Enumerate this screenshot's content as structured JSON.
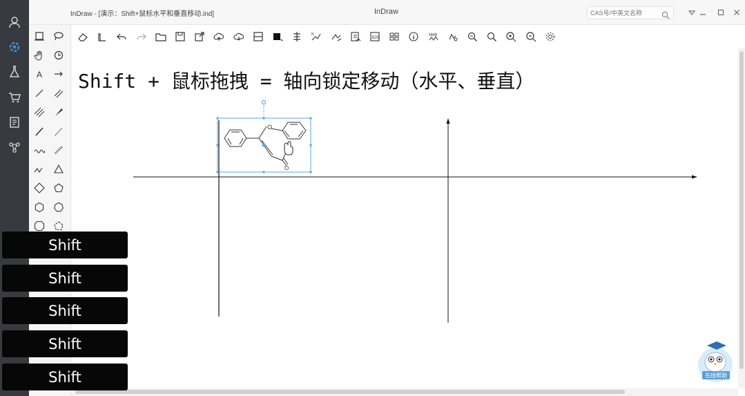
{
  "window": {
    "doc_title": "InDraw - [演示：Shift+鼠标水平和垂直移动.ind]",
    "app_title": "InDraw",
    "search_placeholder": "CAS号/中英文名称",
    "controls": [
      "dropdown-icon",
      "minimize-icon",
      "maximize-icon",
      "close-icon"
    ]
  },
  "left_rail": {
    "items": [
      {
        "icon": "user-icon",
        "active": false
      },
      {
        "icon": "gear-cycle-icon",
        "active": true,
        "color": "#3b8fd9"
      },
      {
        "icon": "flask-icon",
        "active": false
      },
      {
        "icon": "cart-icon",
        "active": false
      },
      {
        "icon": "notes-icon",
        "active": false
      },
      {
        "icon": "molecule-network-icon",
        "active": false
      }
    ]
  },
  "palette": {
    "tools": [
      "select-rect-icon",
      "lasso-icon",
      "hand-pan-icon",
      "rotate-icon",
      "text-A-icon",
      "arrow-right-icon",
      "single-bond-icon",
      "double-bond-icon",
      "triple-bond-icon",
      "bold-wedge-icon",
      "plain-bond-icon",
      "wedge-bond-icon",
      "wavy-bond-icon",
      "hash-bond-icon",
      "chain-icon",
      "triangle-ring-icon",
      "square-ring-icon",
      "pentagon-ring-icon",
      "hexagon-ring-icon",
      "heptagon-ring-icon",
      "octagon-ring-icon",
      "cyclopentane-icon"
    ]
  },
  "toolbar": {
    "tools": [
      "eraser-icon",
      "clean-icon",
      "undo-icon",
      "redo-icon",
      "open-folder-icon",
      "save-icon",
      "export-icon",
      "cloud-up-icon",
      "cloud-down-icon",
      "split-icon",
      "color-square-icon",
      "align-icon",
      "name-to-structure-icon",
      "structure-to-name-icon",
      "check-icon",
      "template-icon",
      "ids-icon",
      "grid-icon",
      "info-icon",
      "nmr-icon",
      "chem-search-icon",
      "zoom-fit-icon",
      "zoom-in-icon",
      "zoom-out-icon",
      "settings-icon"
    ],
    "ids_label": "IDS",
    "nmr_label": "NMR"
  },
  "canvas": {
    "title": "Shift + 鼠标拖拽 = 轴向锁定移动（水平、垂直）",
    "atom_labels": {
      "ring_O": "O",
      "carbonyl_O": "O"
    }
  },
  "overlay": {
    "keys": [
      "Shift",
      "Shift",
      "Shift",
      "Shift",
      "Shift"
    ],
    "badge_color": "#070707"
  },
  "mascot": {
    "label": "在线帮助"
  },
  "colors": {
    "rail": "#373a3e",
    "selection": "#58a6e8",
    "accent": "#3b8fd9"
  }
}
